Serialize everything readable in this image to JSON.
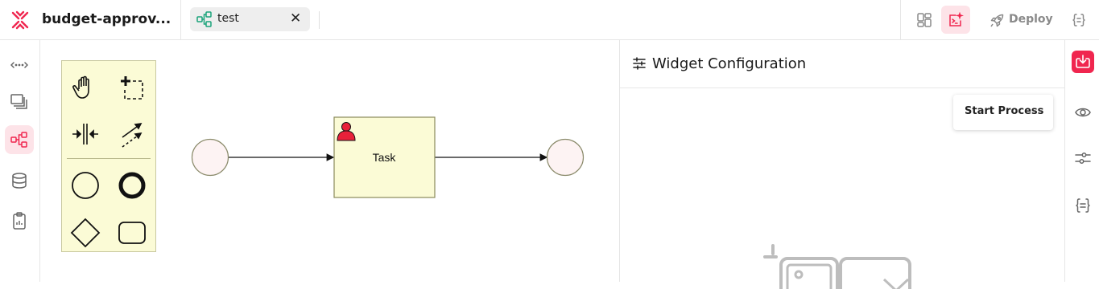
{
  "app": {
    "title": "budget-approv...",
    "brand_color": "#f0264f"
  },
  "tabs": [
    {
      "label": "test",
      "icon": "workflow-icon"
    }
  ],
  "toolbar": {
    "deploy_label": "Deploy",
    "buttons": [
      "grid-view-icon",
      "script-icon",
      "rocket-icon",
      "code-braces-icon"
    ]
  },
  "left_sidebar": {
    "items": [
      "expand-arrows-icon",
      "layers-icon",
      "workflow-icon",
      "database-icon",
      "clipboard-icon"
    ],
    "active": "workflow-icon"
  },
  "palette": {
    "tools": [
      "hand-tool-icon",
      "lasso-tool-icon",
      "space-tool-icon",
      "connect-tool-icon",
      "start-event-icon",
      "end-event-icon",
      "gateway-icon",
      "task-icon"
    ]
  },
  "diagram": {
    "task_label": "Task",
    "task_fill": "#fbfbd6",
    "event_fill": "#fdf3f3",
    "performer_color": "#e8213a"
  },
  "config_panel": {
    "title": "Widget Configuration",
    "tooltip": "Start Process"
  },
  "right_sidebar": {
    "items": [
      "download-icon",
      "eye-icon",
      "sliders-icon",
      "code-braces-icon"
    ]
  }
}
